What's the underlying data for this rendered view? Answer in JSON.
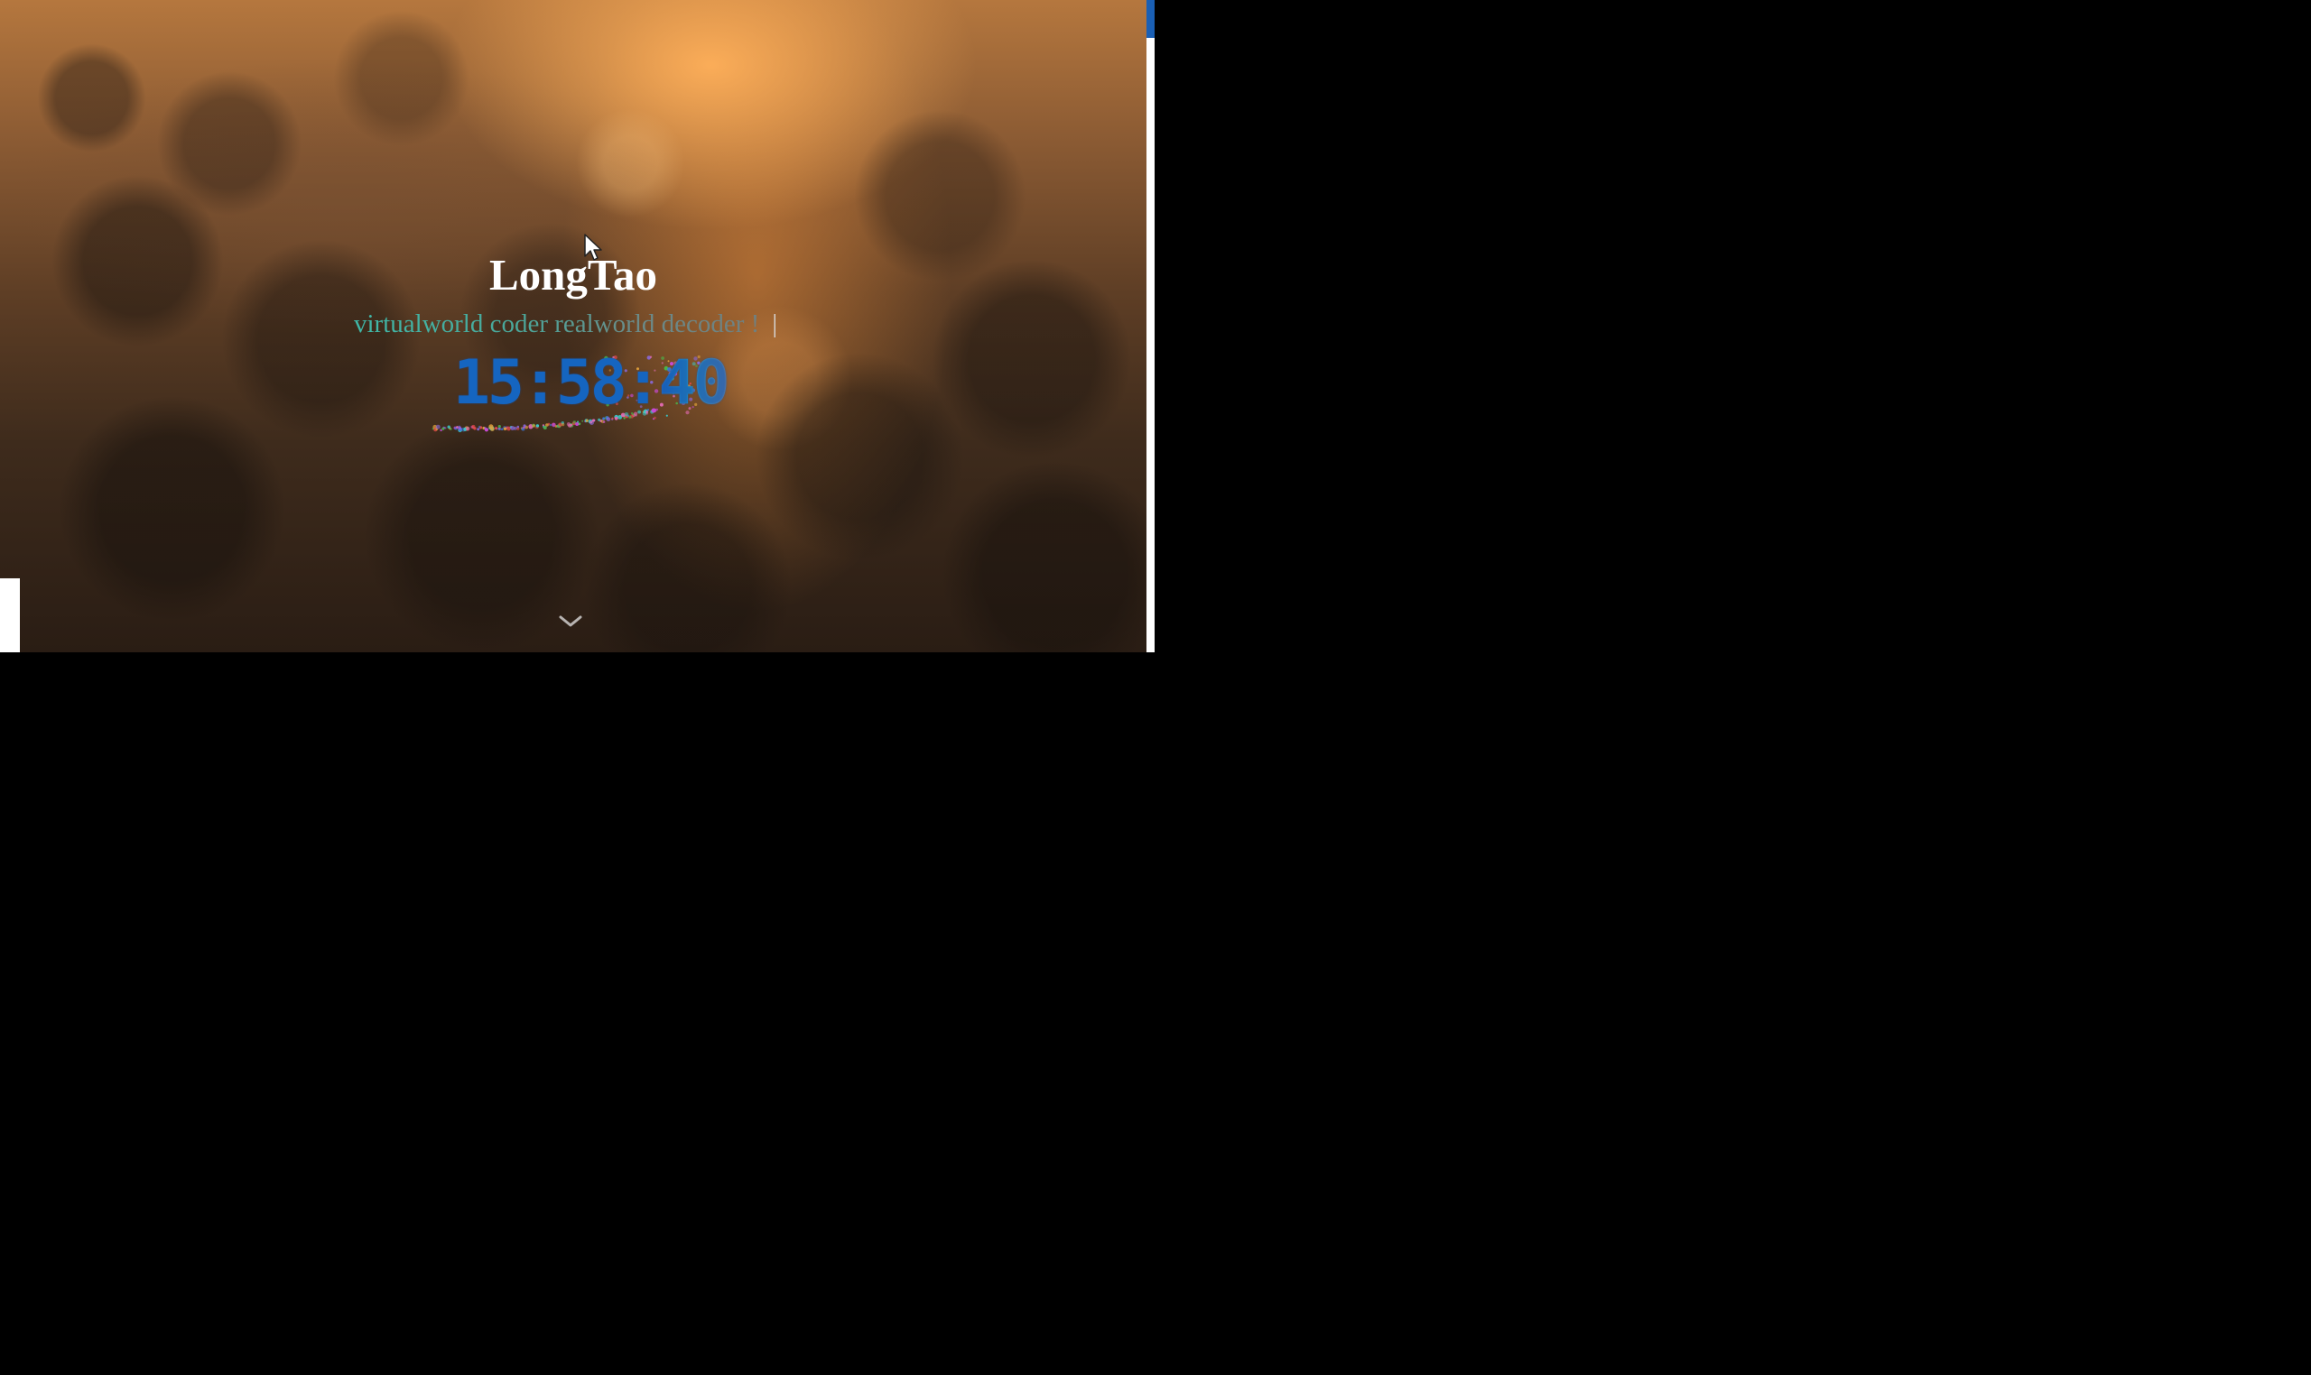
{
  "site": {
    "title": "LongTao",
    "subtitle": "virtualworld coder realworld decoder !",
    "caret": "|"
  },
  "clock": {
    "hours_minutes": "15:58:",
    "seconds": "40"
  },
  "icons": {
    "scroll_down": "chevron-down-icon",
    "cursor": "mouse-pointer-icon"
  },
  "colors": {
    "clock": "#1565c0",
    "title": "#ffffff",
    "subtitle_start": "#3fb8a8",
    "progress": "#1a5fb4"
  }
}
